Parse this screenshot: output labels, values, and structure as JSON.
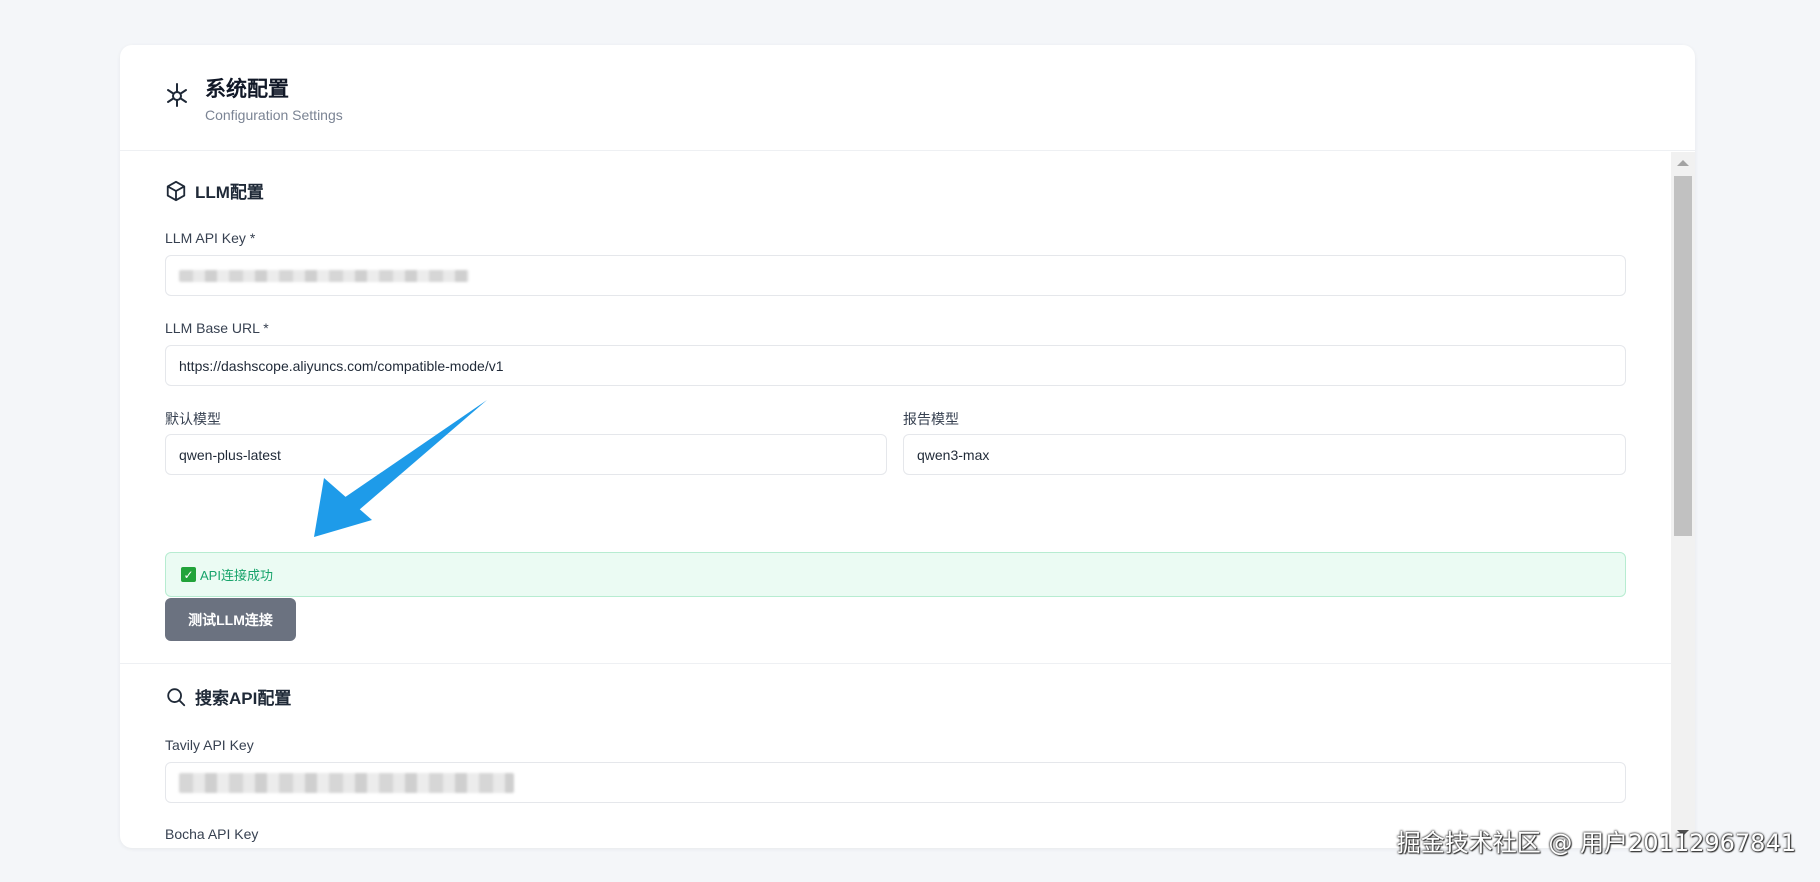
{
  "header": {
    "title": "系统配置",
    "subtitle": "Configuration Settings",
    "icon": "sparkle-gear-icon"
  },
  "llm": {
    "section_title": "LLM配置",
    "section_icon": "cube-icon",
    "api_key_label": "LLM API Key *",
    "base_url_label": "LLM Base URL *",
    "base_url_value": "https://dashscope.aliyuncs.com/compatible-mode/v1",
    "default_model_label": "默认模型",
    "default_model_value": "qwen-plus-latest",
    "report_model_label": "报告模型",
    "report_model_value": "qwen3-max",
    "status_icon": "check-icon",
    "status_text": "API连接成功",
    "test_button_label": "测试LLM连接"
  },
  "search": {
    "section_title": "搜索API配置",
    "section_icon": "search-icon",
    "tavily_label": "Tavily API Key",
    "bocha_label": "Bocha API Key"
  },
  "colors": {
    "success_bg": "#ebfbf3",
    "success_text": "#16a36a",
    "button_bg": "#6b7280",
    "arrow": "#1e9be9"
  },
  "watermark": "掘金技术社区 @ 用户20112967841"
}
